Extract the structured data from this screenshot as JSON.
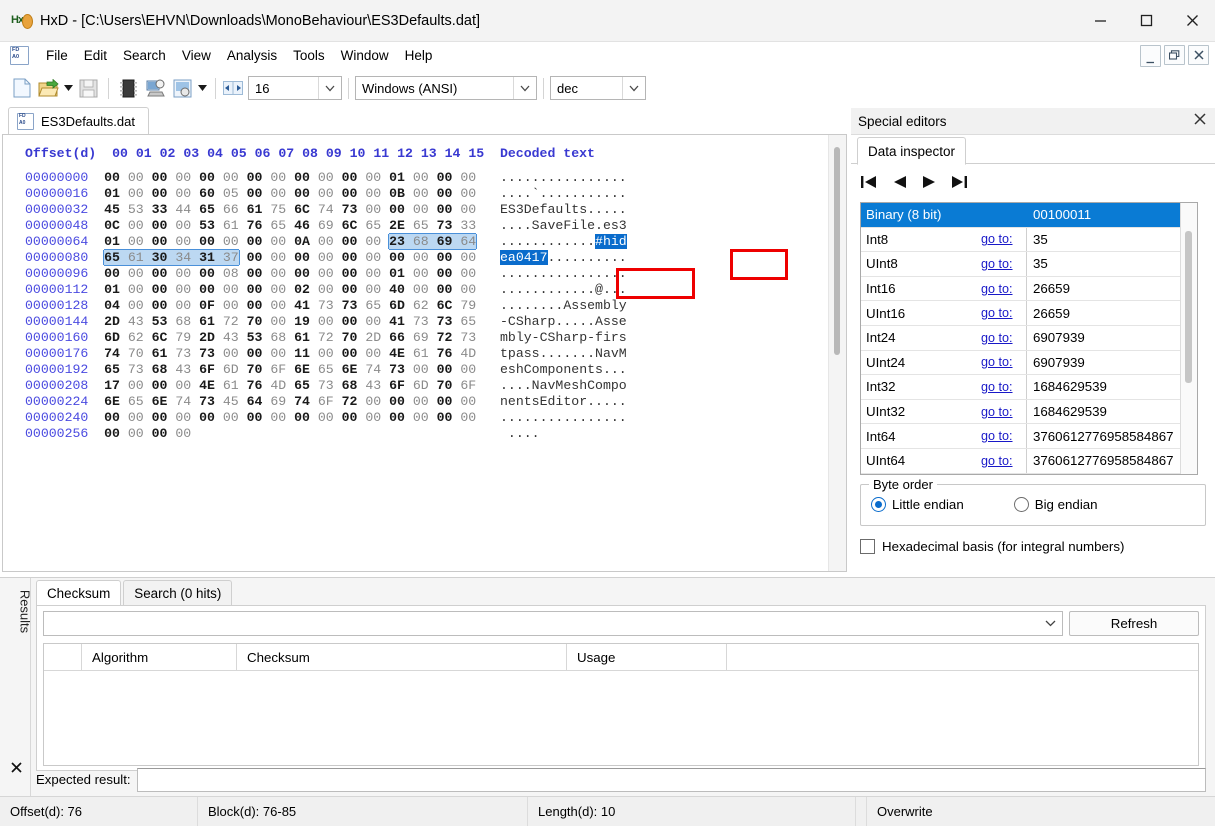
{
  "window": {
    "title": "HxD - [C:\\Users\\EHVN\\Downloads\\MonoBehaviour\\ES3Defaults.dat]",
    "app_icon": "hxd-logo-icon",
    "minimize": "minimize-icon",
    "maximize": "maximize-icon",
    "close": "close-icon"
  },
  "menubar": {
    "items": [
      {
        "label": "File"
      },
      {
        "label": "Edit"
      },
      {
        "label": "Search"
      },
      {
        "label": "View"
      },
      {
        "label": "Analysis"
      },
      {
        "label": "Tools"
      },
      {
        "label": "Window"
      },
      {
        "label": "Help"
      }
    ],
    "mdi": {
      "minimize": "_",
      "restore": "❐",
      "close": "✕"
    }
  },
  "toolbar": {
    "icons": [
      {
        "name": "new-file-icon"
      },
      {
        "name": "open-file-icon"
      },
      {
        "name": "open-dropdown-arrow-icon"
      },
      {
        "name": "save-file-icon"
      },
      {
        "name": "open-disk-icon"
      },
      {
        "name": "open-ram-icon"
      },
      {
        "name": "open-process-icon"
      },
      {
        "name": "process-dropdown-arrow-icon"
      },
      {
        "name": "bytes-per-row-icon"
      }
    ],
    "bytes_per_row": "16",
    "encoding": "Windows (ANSI)",
    "offset_base": "dec"
  },
  "document_tab": {
    "label": "ES3Defaults.dat",
    "icon": "file-icon"
  },
  "hex_view": {
    "header": {
      "offset_label": "Offset(d)",
      "columns": [
        "00",
        "01",
        "02",
        "03",
        "04",
        "05",
        "06",
        "07",
        "08",
        "09",
        "10",
        "11",
        "12",
        "13",
        "14",
        "15"
      ],
      "decoded_label": "Decoded text"
    },
    "rows": [
      {
        "offset": "00000000",
        "bytes": [
          "00",
          "00",
          "00",
          "00",
          "00",
          "00",
          "00",
          "00",
          "00",
          "00",
          "00",
          "00",
          "01",
          "00",
          "00",
          "00"
        ],
        "text": "................"
      },
      {
        "offset": "00000016",
        "bytes": [
          "01",
          "00",
          "00",
          "00",
          "60",
          "05",
          "00",
          "00",
          "00",
          "00",
          "00",
          "00",
          "0B",
          "00",
          "00",
          "00"
        ],
        "text": "....`..........."
      },
      {
        "offset": "00000032",
        "bytes": [
          "45",
          "53",
          "33",
          "44",
          "65",
          "66",
          "61",
          "75",
          "6C",
          "74",
          "73",
          "00",
          "00",
          "00",
          "00",
          "00"
        ],
        "text": "ES3Defaults....."
      },
      {
        "offset": "00000048",
        "bytes": [
          "0C",
          "00",
          "00",
          "00",
          "53",
          "61",
          "76",
          "65",
          "46",
          "69",
          "6C",
          "65",
          "2E",
          "65",
          "73",
          "33"
        ],
        "text": "....SaveFile.es3"
      },
      {
        "offset": "00000064",
        "bytes": [
          "01",
          "00",
          "00",
          "00",
          "00",
          "00",
          "00",
          "00",
          "0A",
          "00",
          "00",
          "00",
          "23",
          "68",
          "69",
          "64"
        ],
        "text": "............#hid",
        "hex_selection": [
          12,
          13,
          14,
          15
        ],
        "text_selection": [
          12,
          13,
          14,
          15
        ]
      },
      {
        "offset": "00000080",
        "bytes": [
          "65",
          "61",
          "30",
          "34",
          "31",
          "37",
          "00",
          "00",
          "00",
          "00",
          "00",
          "00",
          "00",
          "00",
          "00",
          "00"
        ],
        "text": "ea0417..........",
        "hex_selection": [
          0,
          1,
          2,
          3,
          4,
          5
        ],
        "text_selection": [
          0,
          1,
          2,
          3,
          4,
          5
        ]
      },
      {
        "offset": "00000096",
        "bytes": [
          "00",
          "00",
          "00",
          "00",
          "00",
          "08",
          "00",
          "00",
          "00",
          "00",
          "00",
          "00",
          "01",
          "00",
          "00",
          "00"
        ],
        "text": "................"
      },
      {
        "offset": "00000112",
        "bytes": [
          "01",
          "00",
          "00",
          "00",
          "00",
          "00",
          "00",
          "00",
          "02",
          "00",
          "00",
          "00",
          "40",
          "00",
          "00",
          "00"
        ],
        "text": "............@..."
      },
      {
        "offset": "00000128",
        "bytes": [
          "04",
          "00",
          "00",
          "00",
          "0F",
          "00",
          "00",
          "00",
          "41",
          "73",
          "73",
          "65",
          "6D",
          "62",
          "6C",
          "79"
        ],
        "text": "........Assembly"
      },
      {
        "offset": "00000144",
        "bytes": [
          "2D",
          "43",
          "53",
          "68",
          "61",
          "72",
          "70",
          "00",
          "19",
          "00",
          "00",
          "00",
          "41",
          "73",
          "73",
          "65"
        ],
        "text": "-CSharp.....Asse"
      },
      {
        "offset": "00000160",
        "bytes": [
          "6D",
          "62",
          "6C",
          "79",
          "2D",
          "43",
          "53",
          "68",
          "61",
          "72",
          "70",
          "2D",
          "66",
          "69",
          "72",
          "73"
        ],
        "text": "mbly-CSharp-firs"
      },
      {
        "offset": "00000176",
        "bytes": [
          "74",
          "70",
          "61",
          "73",
          "73",
          "00",
          "00",
          "00",
          "11",
          "00",
          "00",
          "00",
          "4E",
          "61",
          "76",
          "4D"
        ],
        "text": "tpass.......NavM"
      },
      {
        "offset": "00000192",
        "bytes": [
          "65",
          "73",
          "68",
          "43",
          "6F",
          "6D",
          "70",
          "6F",
          "6E",
          "65",
          "6E",
          "74",
          "73",
          "00",
          "00",
          "00"
        ],
        "text": "eshComponents..."
      },
      {
        "offset": "00000208",
        "bytes": [
          "17",
          "00",
          "00",
          "00",
          "4E",
          "61",
          "76",
          "4D",
          "65",
          "73",
          "68",
          "43",
          "6F",
          "6D",
          "70",
          "6F"
        ],
        "text": "....NavMeshCompo"
      },
      {
        "offset": "00000224",
        "bytes": [
          "6E",
          "65",
          "6E",
          "74",
          "73",
          "45",
          "64",
          "69",
          "74",
          "6F",
          "72",
          "00",
          "00",
          "00",
          "00",
          "00"
        ],
        "text": "nentsEditor....."
      },
      {
        "offset": "00000240",
        "bytes": [
          "00",
          "00",
          "00",
          "00",
          "00",
          "00",
          "00",
          "00",
          "00",
          "00",
          "00",
          "00",
          "00",
          "00",
          "00",
          "00"
        ],
        "text": "................"
      },
      {
        "offset": "00000256",
        "bytes": [
          "00",
          "00",
          "00",
          "00"
        ],
        "text": "...."
      }
    ]
  },
  "special_editors": {
    "title": "Special editors",
    "close_icon": "close-icon",
    "tab": "Data inspector",
    "nav": [
      {
        "name": "first-icon",
        "glyph": "first"
      },
      {
        "name": "previous-icon",
        "glyph": "prev"
      },
      {
        "name": "next-icon",
        "glyph": "next"
      },
      {
        "name": "last-icon",
        "glyph": "last"
      }
    ],
    "goto_label": "go to:",
    "rows": [
      {
        "type": "Binary (8 bit)",
        "goto": "",
        "value": "00100011",
        "selected": true
      },
      {
        "type": "Int8",
        "goto": "go to:",
        "value": "35"
      },
      {
        "type": "UInt8",
        "goto": "go to:",
        "value": "35"
      },
      {
        "type": "Int16",
        "goto": "go to:",
        "value": "26659"
      },
      {
        "type": "UInt16",
        "goto": "go to:",
        "value": "26659"
      },
      {
        "type": "Int24",
        "goto": "go to:",
        "value": "6907939"
      },
      {
        "type": "UInt24",
        "goto": "go to:",
        "value": "6907939"
      },
      {
        "type": "Int32",
        "goto": "go to:",
        "value": "1684629539"
      },
      {
        "type": "UInt32",
        "goto": "go to:",
        "value": "1684629539"
      },
      {
        "type": "Int64",
        "goto": "go to:",
        "value": "3760612776958584867"
      },
      {
        "type": "UInt64",
        "goto": "go to:",
        "value": "3760612776958584867"
      }
    ],
    "byte_order": {
      "legend": "Byte order",
      "little_endian": "Little endian",
      "big_endian": "Big endian",
      "selected": "little"
    },
    "hex_basis": {
      "label": "Hexadecimal basis (for integral numbers)",
      "checked": false
    }
  },
  "results": {
    "side_label": "Results",
    "close_icon": "close-icon",
    "tabs": [
      {
        "label": "Checksum",
        "active": true
      },
      {
        "label": "Search (0 hits)",
        "active": false
      }
    ],
    "algorithm_combo": {
      "value": "",
      "placeholder": ""
    },
    "refresh_button": "Refresh",
    "table_headers": [
      "",
      "Algorithm",
      "Checksum",
      "Usage"
    ],
    "rows": [],
    "expected_result": {
      "label": "Expected result:",
      "value": ""
    }
  },
  "statusbar": {
    "offset": "Offset(d): 76",
    "block": "Block(d): 76-85",
    "length": "Length(d): 10",
    "blank": "",
    "mode": "Overwrite"
  },
  "colors": {
    "accent": "#0a6ccc",
    "selection_soft": "#bcd8f2",
    "selection_strong": "#0a7bd4",
    "annotation": "#ee0000",
    "offset_text": "#4a4ae0",
    "header_text": "#3939d1"
  }
}
